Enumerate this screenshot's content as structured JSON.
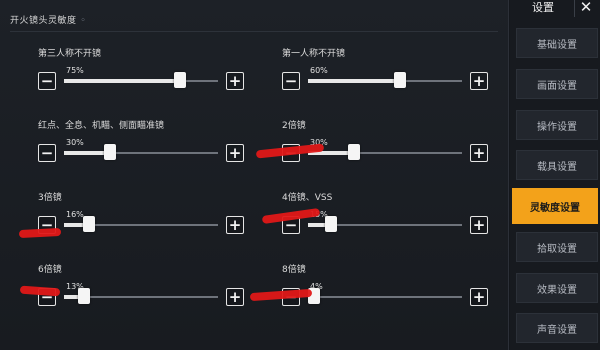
{
  "section": {
    "title": "开火镜头灵敏度",
    "dot": "◦"
  },
  "sliders": [
    {
      "label": "第三人称不开镜",
      "value_text": "75%",
      "value": 75
    },
    {
      "label": "第一人称不开镜",
      "value_text": "60%",
      "value": 60
    },
    {
      "label": "红点、全息、机瞄、侧面瞄准镜",
      "value_text": "30%",
      "value": 30
    },
    {
      "label": "2倍镜",
      "value_text": "30%",
      "value": 30
    },
    {
      "label": "3倍镜",
      "value_text": "16%",
      "value": 16
    },
    {
      "label": "4倍镜、VSS",
      "value_text": "15%",
      "value": 15
    },
    {
      "label": "6倍镜",
      "value_text": "13%",
      "value": 13
    },
    {
      "label": "8倍镜",
      "value_text": "4%",
      "value": 4
    }
  ],
  "buttons": {
    "minus": "−",
    "plus": "+"
  },
  "header": {
    "title": "设置",
    "close": "✕"
  },
  "sidebar": {
    "items": [
      {
        "label": "基础设置",
        "active": false
      },
      {
        "label": "画面设置",
        "active": false
      },
      {
        "label": "操作设置",
        "active": false
      },
      {
        "label": "载具设置",
        "active": false
      },
      {
        "label": "灵敏度设置",
        "active": true
      },
      {
        "label": "拾取设置",
        "active": false
      },
      {
        "label": "效果设置",
        "active": false
      },
      {
        "label": "声音设置",
        "active": false
      }
    ]
  },
  "colors": {
    "accent": "#f3a21a",
    "annotation": "#e01818"
  }
}
